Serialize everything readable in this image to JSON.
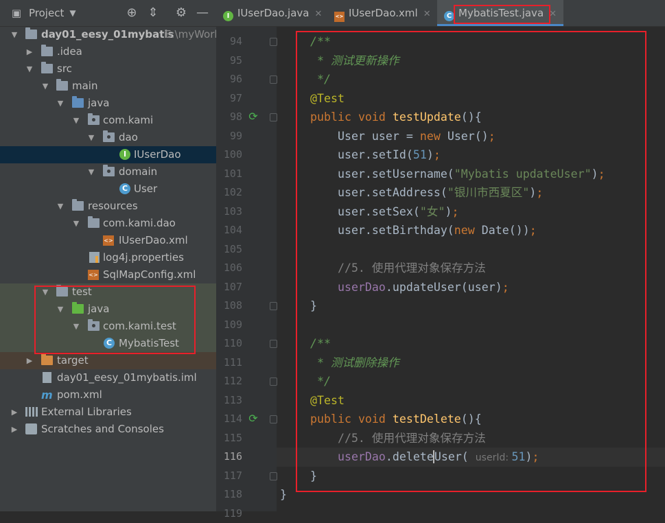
{
  "project_panel": {
    "title": "Project",
    "tree": [
      {
        "label": "day01_eesy_01mybatis",
        "hint": "E:\\myWork"
      },
      {
        "label": ".idea"
      },
      {
        "label": "src"
      },
      {
        "label": "main"
      },
      {
        "label": "java"
      },
      {
        "label": "com.kami"
      },
      {
        "label": "dao"
      },
      {
        "label": "IUserDao",
        "icon_letter": "I"
      },
      {
        "label": "domain"
      },
      {
        "label": "User",
        "icon_letter": "C"
      },
      {
        "label": "resources"
      },
      {
        "label": "com.kami.dao"
      },
      {
        "label": "IUserDao.xml",
        "icon_text": "<>"
      },
      {
        "label": "log4j.properties"
      },
      {
        "label": "SqlMapConfig.xml",
        "icon_text": "<>"
      },
      {
        "label": "test"
      },
      {
        "label": "java"
      },
      {
        "label": "com.kami.test"
      },
      {
        "label": "MybatisTest",
        "icon_letter": "C"
      },
      {
        "label": "target"
      },
      {
        "label": "day01_eesy_01mybatis.iml"
      },
      {
        "label": "pom.xml",
        "icon_letter": "m"
      },
      {
        "label": "External Libraries"
      },
      {
        "label": "Scratches and Consoles"
      }
    ]
  },
  "tabs": [
    {
      "label": "IUserDao.java",
      "icon_letter": "I"
    },
    {
      "label": "IUserDao.xml",
      "icon_text": "<>"
    },
    {
      "label": "MybatisTest.java",
      "icon_letter": "C"
    }
  ],
  "editor": {
    "current_line": 116,
    "lines": [
      {
        "n": 94,
        "t": [
          [
            "doc",
            "/**"
          ]
        ]
      },
      {
        "n": 95,
        "t": [
          [
            "doc",
            " * 测试更新操作"
          ]
        ]
      },
      {
        "n": 96,
        "t": [
          [
            "doc",
            " */"
          ]
        ]
      },
      {
        "n": 97,
        "t": [
          [
            "ann",
            "@Test"
          ]
        ]
      },
      {
        "n": 98,
        "t": [
          [
            "kw",
            "public "
          ],
          [
            "kw",
            "void "
          ],
          [
            "fn",
            "testUpdate"
          ],
          [
            "",
            "(){"
          ]
        ]
      },
      {
        "n": 99,
        "t": [
          [
            "",
            "    User user = "
          ],
          [
            "kw",
            "new "
          ],
          [
            "",
            "User()"
          ],
          [
            "kw",
            ";"
          ]
        ]
      },
      {
        "n": 100,
        "t": [
          [
            "",
            "    user.setId("
          ],
          [
            "num",
            "51"
          ],
          [
            "",
            ")"
          ],
          [
            "kw",
            ";"
          ]
        ]
      },
      {
        "n": 101,
        "t": [
          [
            "",
            "    user.setUsername("
          ],
          [
            "str",
            "\"Mybatis updateUser\""
          ],
          [
            "",
            ")"
          ],
          [
            "kw",
            ";"
          ]
        ]
      },
      {
        "n": 102,
        "t": [
          [
            "",
            "    user.setAddress("
          ],
          [
            "str",
            "\"银川市西夏区\""
          ],
          [
            "",
            ")"
          ],
          [
            "kw",
            ";"
          ]
        ]
      },
      {
        "n": 103,
        "t": [
          [
            "",
            "    user.setSex("
          ],
          [
            "str",
            "\"女\""
          ],
          [
            "",
            ")"
          ],
          [
            "kw",
            ";"
          ]
        ]
      },
      {
        "n": 104,
        "t": [
          [
            "",
            "    user.setBirthday("
          ],
          [
            "kw",
            "new "
          ],
          [
            "",
            "Date())"
          ],
          [
            "kw",
            ";"
          ]
        ]
      },
      {
        "n": 105,
        "t": []
      },
      {
        "n": 106,
        "t": [
          [
            "cmt",
            "    //5. 使用代理对象保存方法"
          ]
        ]
      },
      {
        "n": 107,
        "t": [
          [
            "fld",
            "    userDao"
          ],
          [
            "",
            ".updateUser(user)"
          ],
          [
            "kw",
            ";"
          ]
        ]
      },
      {
        "n": 108,
        "t": [
          [
            "",
            "}"
          ]
        ]
      },
      {
        "n": 109,
        "t": []
      },
      {
        "n": 110,
        "t": [
          [
            "doc",
            "/**"
          ]
        ]
      },
      {
        "n": 111,
        "t": [
          [
            "doc",
            " * 测试删除操作"
          ]
        ]
      },
      {
        "n": 112,
        "t": [
          [
            "doc",
            " */"
          ]
        ]
      },
      {
        "n": 113,
        "t": [
          [
            "ann",
            "@Test"
          ]
        ]
      },
      {
        "n": 114,
        "t": [
          [
            "kw",
            "public "
          ],
          [
            "kw",
            "void "
          ],
          [
            "fn",
            "testDelete"
          ],
          [
            "",
            "(){"
          ]
        ]
      },
      {
        "n": 115,
        "t": [
          [
            "cmt",
            "    //5. 使用代理对象保存方法"
          ]
        ]
      },
      {
        "n": 116,
        "t": [
          [
            "fld",
            "    userDao"
          ],
          [
            "",
            ".delete"
          ],
          [
            "caret",
            ""
          ],
          [
            "",
            "User( "
          ],
          [
            "ph",
            "userId: "
          ],
          [
            "num",
            "51"
          ],
          [
            "",
            ")"
          ],
          [
            "kw",
            ";"
          ]
        ]
      },
      {
        "n": 117,
        "t": [
          [
            "",
            "}"
          ]
        ]
      },
      {
        "n": 118,
        "t": [
          [
            "",
            "}"
          ]
        ]
      },
      {
        "n": 119,
        "t": []
      }
    ]
  },
  "colors": {
    "highlight_box": "#e8202a",
    "selection": "#0d293e",
    "accent": "#4a88c7"
  }
}
